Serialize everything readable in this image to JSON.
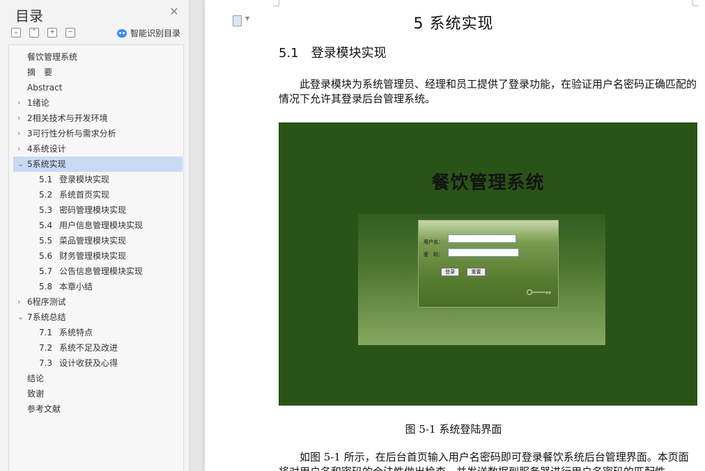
{
  "sidebar": {
    "title": "目录",
    "smart_toc_label": "智能识别目录",
    "items": [
      {
        "text": "餐饮管理系统",
        "arrow": ""
      },
      {
        "text": "摘　要",
        "arrow": ""
      },
      {
        "text": "Abstract",
        "arrow": ""
      },
      {
        "text": "1绪论",
        "arrow": "›"
      },
      {
        "text": "2相关技术与开发环境",
        "arrow": "›"
      },
      {
        "text": "3可行性分析与需求分析",
        "arrow": "›"
      },
      {
        "text": "4系统设计",
        "arrow": "›"
      },
      {
        "text": "5系统实现",
        "arrow": "⌄",
        "selected": true
      },
      {
        "num": "5.1",
        "text": "登录模块实现"
      },
      {
        "num": "5.2",
        "text": "系统首页实现"
      },
      {
        "num": "5.3",
        "text": "密码管理模块实现"
      },
      {
        "num": "5.4",
        "text": "用户信息管理模块实现"
      },
      {
        "num": "5.5",
        "text": "菜品管理模块实现"
      },
      {
        "num": "5.6",
        "text": "财务管理模块实现"
      },
      {
        "num": "5.7",
        "text": "公告信息管理模块实现"
      },
      {
        "num": "5.8",
        "text": "本章小结"
      },
      {
        "text": "6程序测试",
        "arrow": "›"
      },
      {
        "text": "7系统总结",
        "arrow": "⌄"
      },
      {
        "num": "7.1",
        "text": "系统特点"
      },
      {
        "num": "7.2",
        "text": "系统不足及改进"
      },
      {
        "num": "7.3",
        "text": "设计收获及心得"
      },
      {
        "text": "结论",
        "arrow": ""
      },
      {
        "text": "致谢",
        "arrow": ""
      },
      {
        "text": "参考文献",
        "arrow": ""
      }
    ]
  },
  "document": {
    "chapter_title": "5  系统实现",
    "section_title": "5.1　登录模块实现",
    "para1": "此登录模块为系统管理员、经理和员工提供了登录功能，在验证用户名密码正确匹配的情况下允许其登录后台管理系统。",
    "figure": {
      "title": "餐饮管理系统",
      "username_label": "用户名：",
      "password_label": "密　码：",
      "login_button": "登录",
      "reset_button": "重置"
    },
    "caption": "图 5-1  系统登陆界面",
    "para2": "如图 5-1 所示，在后台首页输入用户名密码即可登录餐饮系统后台管理界面。本页面将对用户名和密码的合法性做出检查，并发送数据到服务器进行用户名密码的匹配性"
  }
}
